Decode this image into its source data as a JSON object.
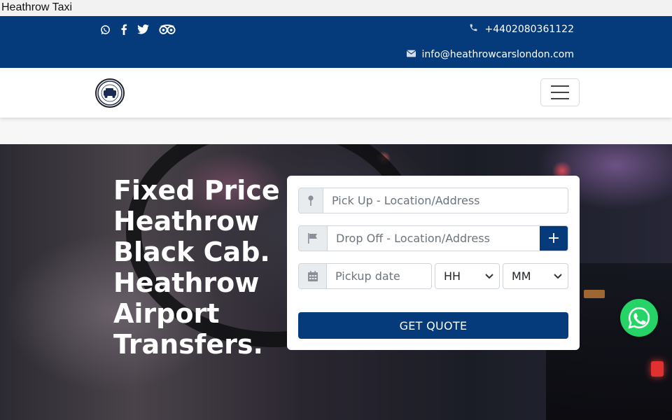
{
  "window": {
    "title": "Heathrow Taxi"
  },
  "topbar": {
    "social_icons": [
      "whatsapp-icon",
      "facebook-icon",
      "twitter-icon",
      "tripadvisor-icon"
    ],
    "phone": "+4402080361122",
    "email": "info@heathrowcarslondon.com"
  },
  "navbar": {
    "logo": "Heathrow Cars logo",
    "menu_icon": "hamburger-menu-icon"
  },
  "hero": {
    "title": "Fixed Price Heathrow Black Cab. Heathrow Airport Transfers."
  },
  "quote_form": {
    "pickup_placeholder": "Pick Up - Location/Address",
    "dropoff_placeholder": "Drop Off - Location/Address",
    "add_stop_label": "+",
    "date_placeholder": "Pickup date",
    "hour_value": "HH",
    "minute_value": "MM",
    "submit_label": "GET QUOTE"
  },
  "colors": {
    "brand": "#053b7a",
    "whatsapp": "#25d366"
  }
}
